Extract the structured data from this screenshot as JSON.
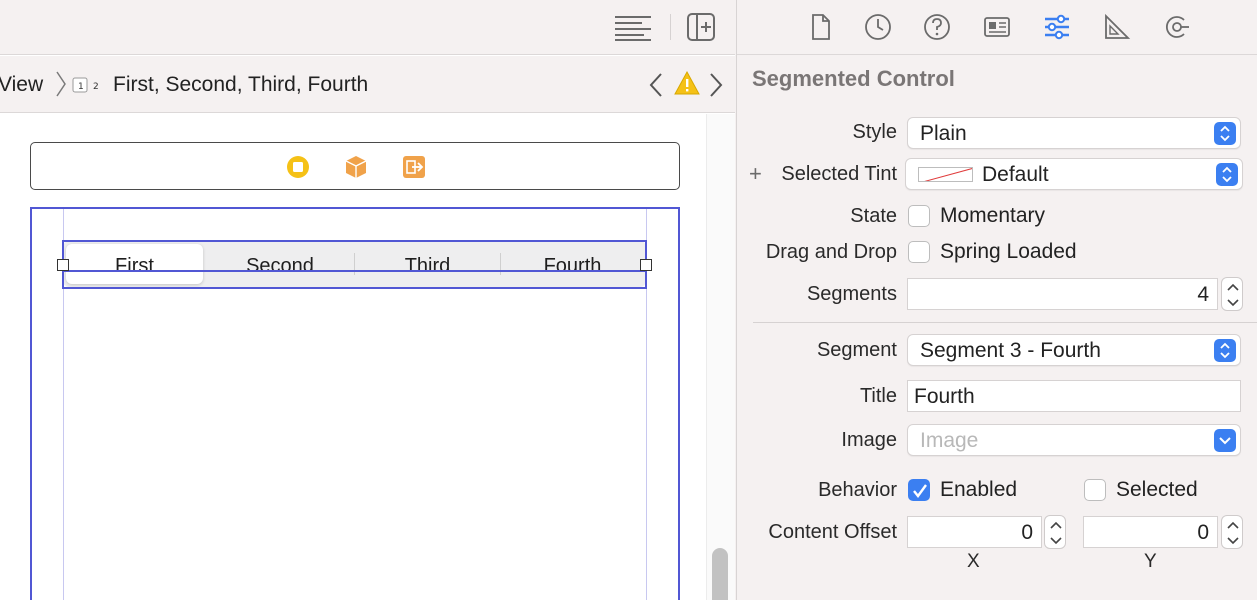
{
  "jumpbar": {
    "view_label": "View",
    "path": "First, Second, Third, Fourth"
  },
  "segmented": {
    "segments": [
      "First",
      "Second",
      "Third",
      "Fourth"
    ]
  },
  "inspector": {
    "title": "Segmented Control",
    "style": {
      "label": "Style",
      "value": "Plain"
    },
    "selected_tint": {
      "label": "Selected Tint",
      "value": "Default"
    },
    "state": {
      "label": "State",
      "option": "Momentary",
      "checked": false
    },
    "drag_drop": {
      "label": "Drag and Drop",
      "option": "Spring Loaded",
      "checked": false
    },
    "segments_count": {
      "label": "Segments",
      "value": "4"
    },
    "segment": {
      "label": "Segment",
      "value": "Segment 3 - Fourth"
    },
    "title_field": {
      "label": "Title",
      "value": "Fourth"
    },
    "image": {
      "label": "Image",
      "placeholder": "Image"
    },
    "behavior": {
      "label": "Behavior",
      "enabled": "Enabled",
      "selected": "Selected",
      "enabled_checked": true,
      "selected_checked": false
    },
    "content_offset": {
      "label": "Content Offset",
      "x": "0",
      "y": "0",
      "x_label": "X",
      "y_label": "Y"
    }
  },
  "colors": {
    "accent": "#3b7ff1",
    "selection": "#5157d4",
    "warning": "#f5c116",
    "object_orange": "#f0a24a"
  },
  "icons": {
    "toolbar": [
      "editor-lines-icon",
      "add-editor-icon"
    ],
    "inspector_tabs": [
      "file-inspector-icon",
      "history-inspector-icon",
      "quick-help-icon",
      "identity-inspector-icon",
      "attributes-inspector-icon",
      "size-inspector-icon",
      "connections-inspector-icon"
    ]
  }
}
